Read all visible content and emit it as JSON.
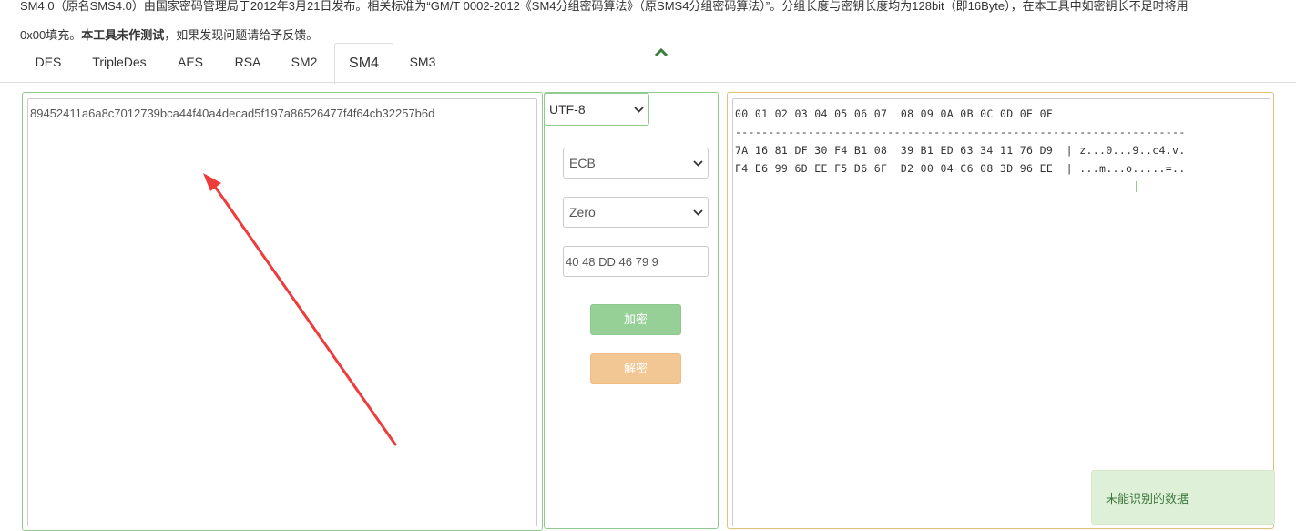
{
  "intro": {
    "line1": "SM4.0（原名SMS4.0）由国家密码管理局于2012年3月21日发布。相关标准为“GM/T 0002-2012《SM4分组密码算法》（原SMS4分组密码算法）”。分组长度与密钥长度均为128bit（即16Byte），在本工具中如密钥长不足时将用",
    "line2_prefix": "0x00填充。",
    "line2_bold": "本工具未作测试",
    "line2_suffix": "，如果发现问题请给予反馈。"
  },
  "tabs": [
    {
      "label": "DES"
    },
    {
      "label": "TripleDes"
    },
    {
      "label": "AES"
    },
    {
      "label": "RSA"
    },
    {
      "label": "SM2"
    },
    {
      "label": "SM4"
    },
    {
      "label": "SM3"
    }
  ],
  "active_tab": "SM4",
  "input": {
    "value": "89452411a6a8c7012739bca44f40a4decad5f197a86526477f4f64cb32257b6d"
  },
  "encoding": {
    "selected": "UTF-8"
  },
  "mode": {
    "selected": "ECB"
  },
  "padding": {
    "selected": "Zero"
  },
  "key": {
    "value": "40 48 DD 46 79 9"
  },
  "buttons": {
    "encrypt": "加密",
    "decrypt": "解密"
  },
  "output": {
    "header": "00 01 02 03 04 05 06 07  08 09 0A 0B 0C 0D 0E 0F",
    "separator": "--------------------------------------------------------------------",
    "rows": [
      "7A 16 81 DF 30 F4 B1 08  39 B1 ED 63 34 11 76 D9  | z...0...9..c4.v.",
      "F4 E6 99 6D EE F5 D6 6F  D2 00 04 C6 08 3D 96 EE  | ...m...o.....=.."
    ]
  },
  "toast": {
    "message": "未能识别的数据"
  },
  "colors": {
    "input_border": "#8fcb8f",
    "output_border": "#e0c27c",
    "encrypt_button": "#96d097",
    "decrypt_button": "#f3c793",
    "annotation_arrow": "#ee3b3b",
    "toast_bg": "#dff0d8"
  },
  "icons": {
    "collapse": "chevron-up-icon",
    "dropdown": "chevron-down-icon",
    "annotation": "red-arrow-annotation"
  }
}
